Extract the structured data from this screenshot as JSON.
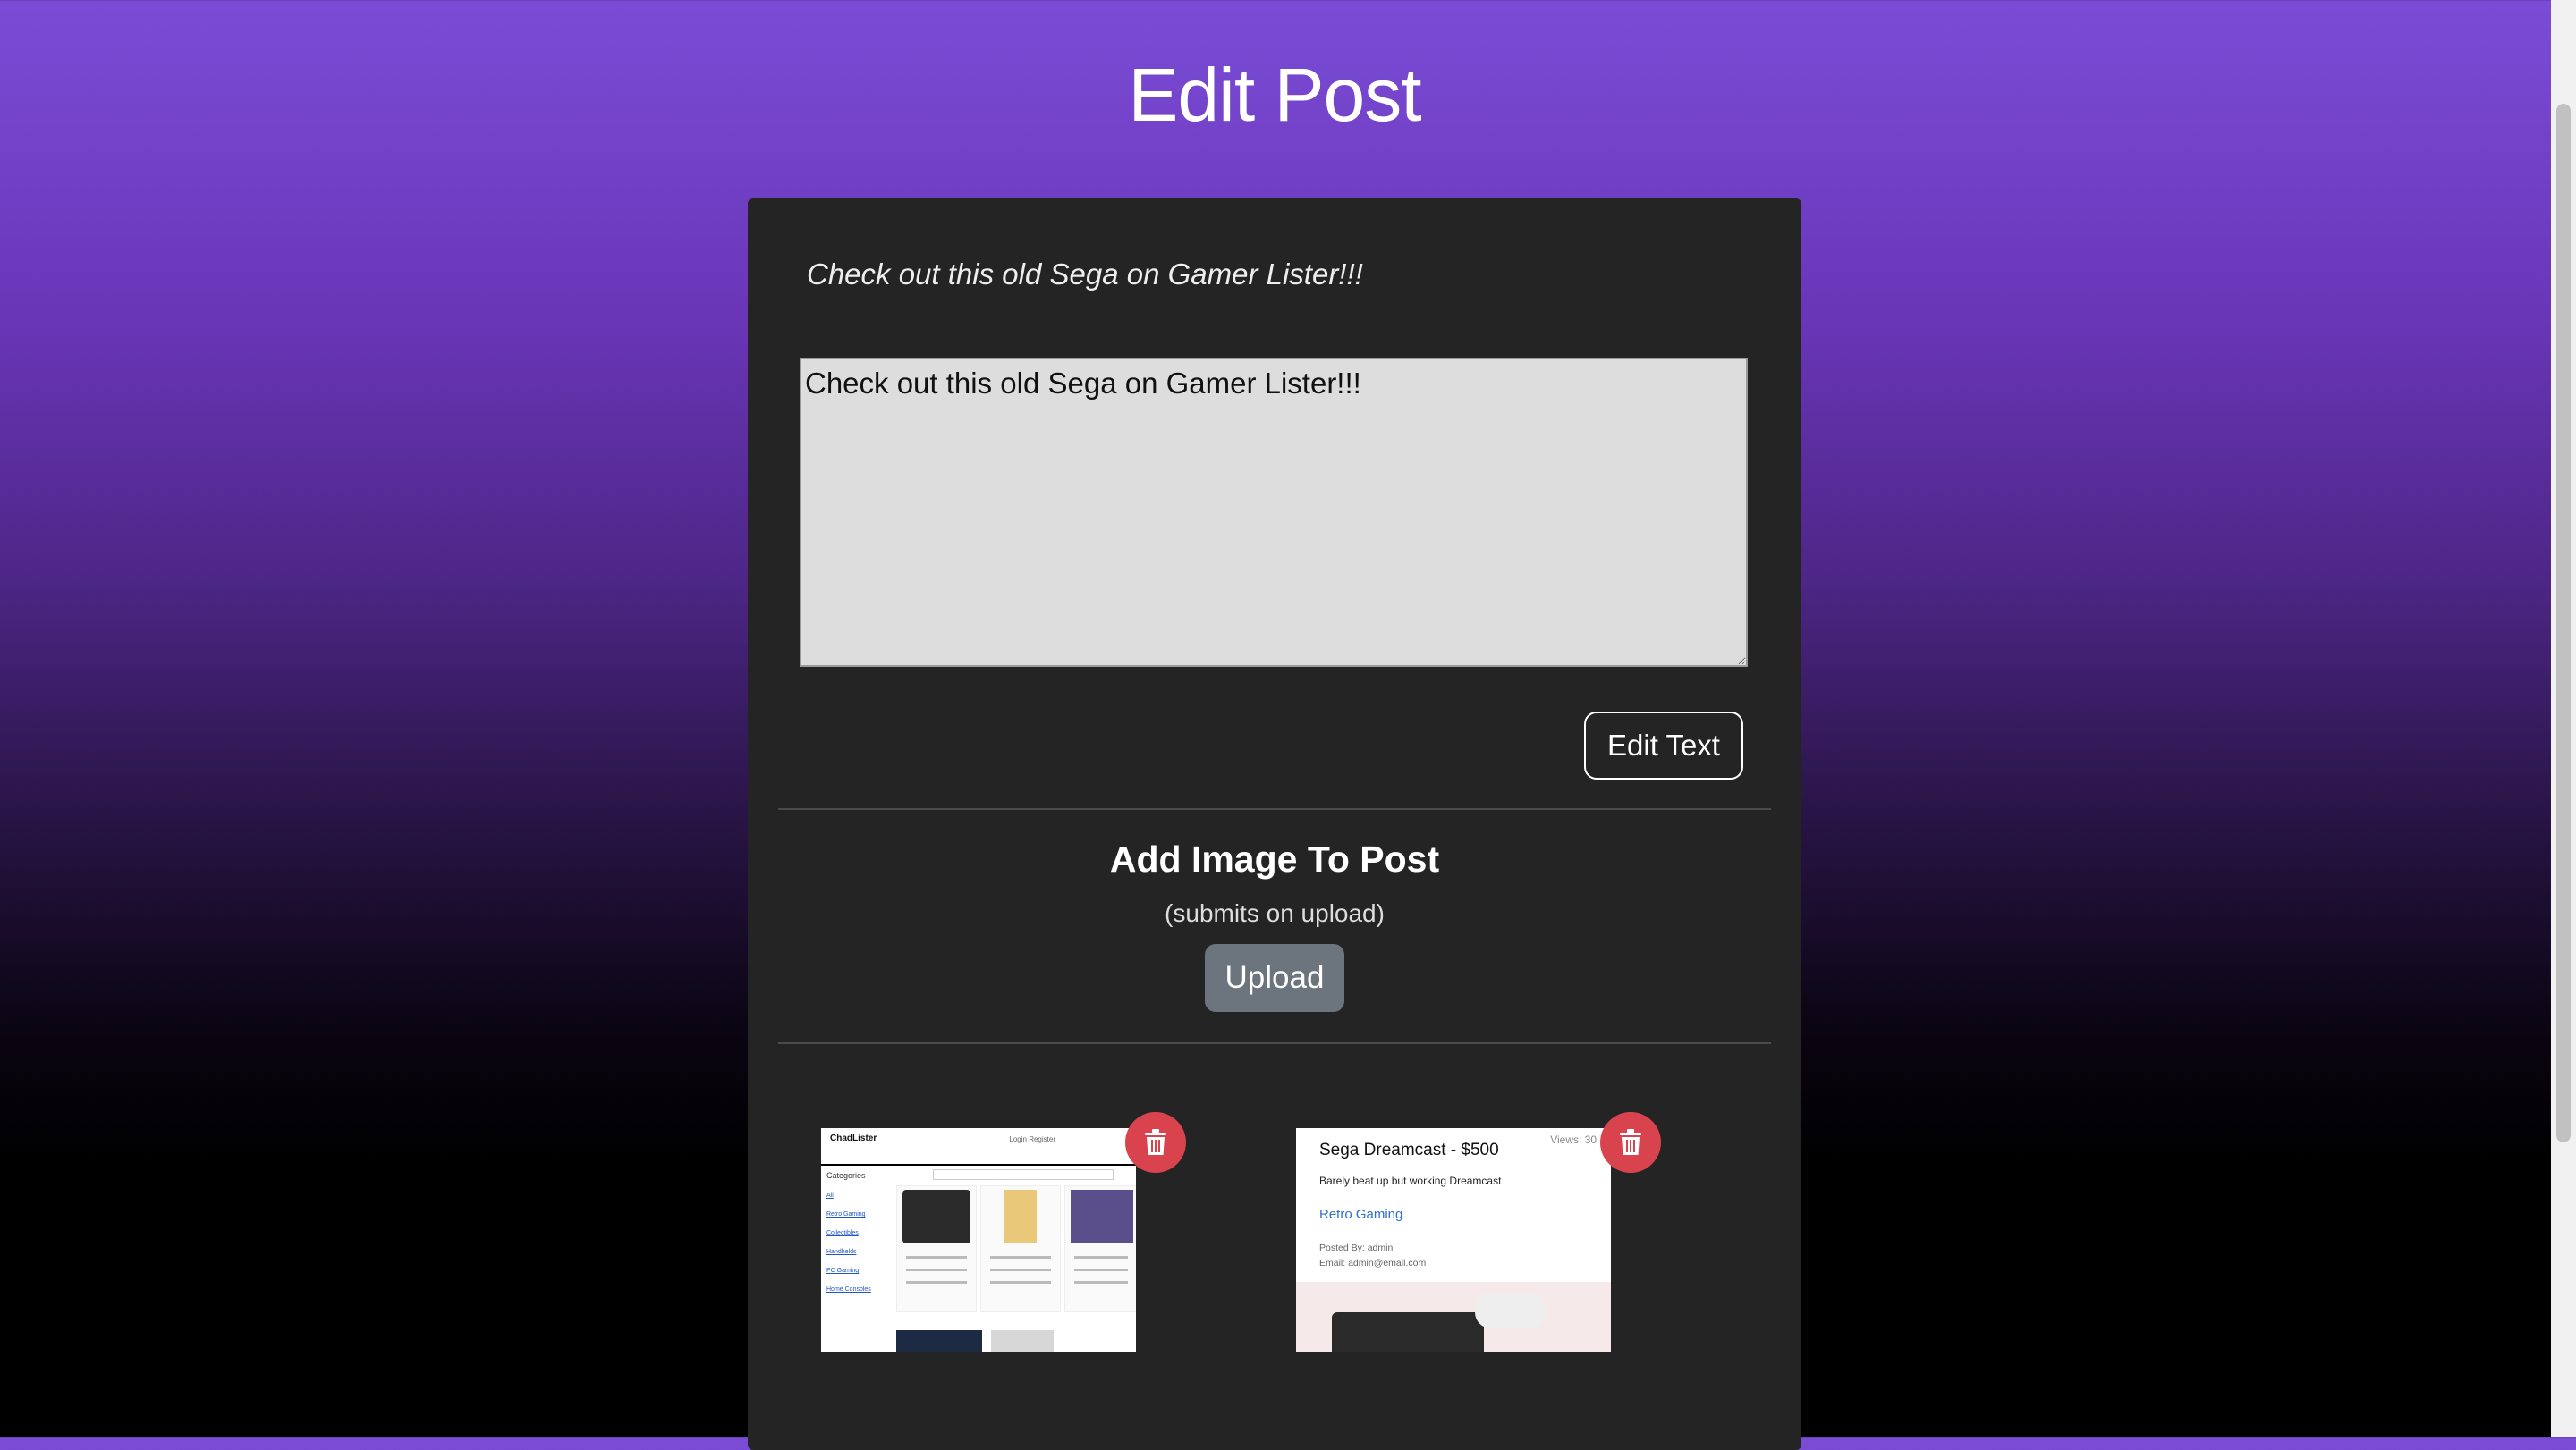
{
  "page": {
    "title": "Edit Post"
  },
  "post": {
    "preview_text": "Check out this old Sega on Gamer Lister!!!",
    "textarea_value": "Check out this old Sega on Gamer Lister!!!",
    "edit_button_label": "Edit Text"
  },
  "upload": {
    "heading": "Add Image To Post",
    "subtext": "(submits on upload)",
    "button_label": "Upload"
  },
  "images": [
    {
      "logo": "ChadLister",
      "nav": "Login   Register",
      "sidebar_title": "Categories",
      "sidebar_items": [
        "All",
        "Retro Gaming",
        "Collectibles",
        "Handhelds",
        "PC Gaming",
        "Home Consoles"
      ],
      "cards": [
        "Sega Dreamcast",
        "1st Edition Dragonite",
        "Nintendo Purple N"
      ]
    },
    {
      "title": "Sega Dreamcast - $500",
      "views": "Views: 30",
      "description": "Barely beat up but working Dreamcast",
      "category": "Retro Gaming",
      "posted_by": "Posted By: admin",
      "email": "Email: admin@email.com"
    }
  ],
  "colors": {
    "delete": "#d9434e",
    "panel": "#252424",
    "upload_button": "#6c757d"
  }
}
